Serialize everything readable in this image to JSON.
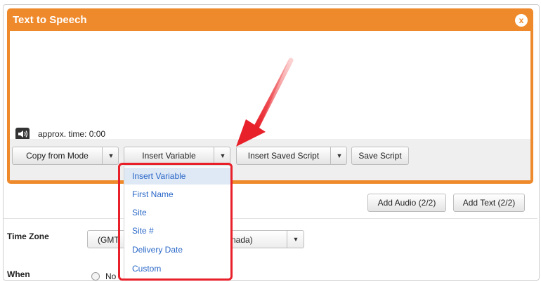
{
  "dialog": {
    "title": "Text to Speech",
    "close_glyph": "x",
    "approx_time": "approx. time: 0:00"
  },
  "toolbar": {
    "copy_from_mode": "Copy from Mode",
    "insert_variable": "Insert Variable",
    "insert_saved_script": "Insert Saved Script",
    "save_script": "Save Script",
    "arrow_glyph": "▼"
  },
  "variable_menu": {
    "items": [
      "Insert Variable",
      "First Name",
      "Site",
      "Site #",
      "Delivery Date",
      "Custom"
    ]
  },
  "actions": {
    "add_audio": "Add Audio (2/2)",
    "add_text": "Add Text (2/2)"
  },
  "form": {
    "time_zone_label": "Time Zone",
    "time_zone_value_left": "(GMT",
    "time_zone_value_right": "nada)",
    "when_label": "When",
    "when_option_partial": "No"
  },
  "colors": {
    "accent_orange": "#ef8a2c",
    "highlight_red": "#e8202a",
    "link_blue": "#2a68c8"
  },
  "icons": [
    "speaker-icon",
    "close-icon",
    "dropdown-arrow-icon",
    "red-arrow-annotation"
  ]
}
